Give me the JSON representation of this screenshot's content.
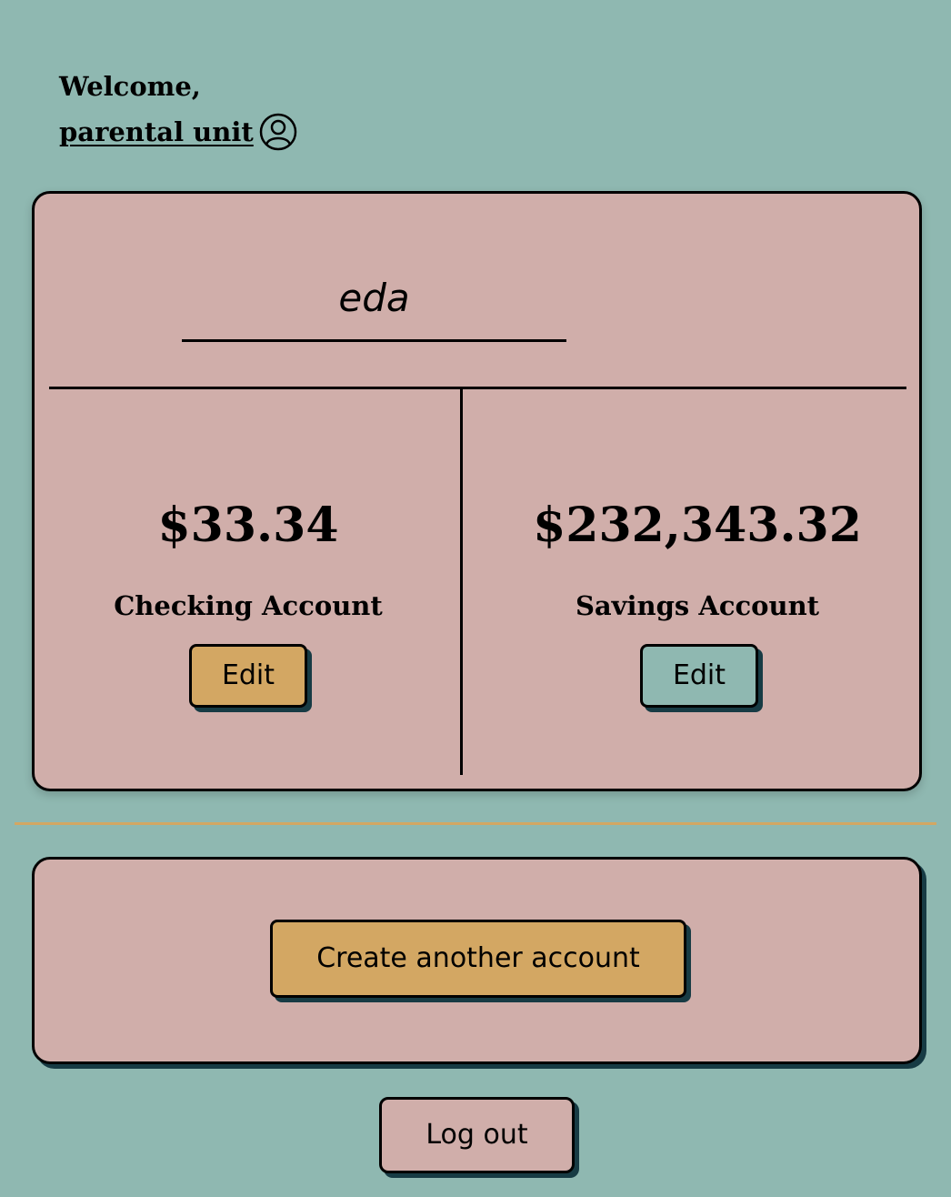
{
  "header": {
    "welcome_text": "Welcome,",
    "username": "parental unit",
    "user_icon": "user-circle-icon"
  },
  "account_group": {
    "owner_name": "eda",
    "accounts": [
      {
        "amount": "$33.34",
        "type": "Checking Account",
        "edit_label": "Edit",
        "button_color": "#d3a763"
      },
      {
        "amount": "$232,343.32",
        "type": "Savings Account",
        "edit_label": "Edit",
        "button_color": "#8fb8b1"
      }
    ]
  },
  "actions": {
    "create_label": "Create another account",
    "logout_label": "Log out"
  },
  "colors": {
    "background": "#8fb8b1",
    "card": "#d0aeaa",
    "accent_gold": "#d3a763",
    "shadow": "#173b44"
  }
}
